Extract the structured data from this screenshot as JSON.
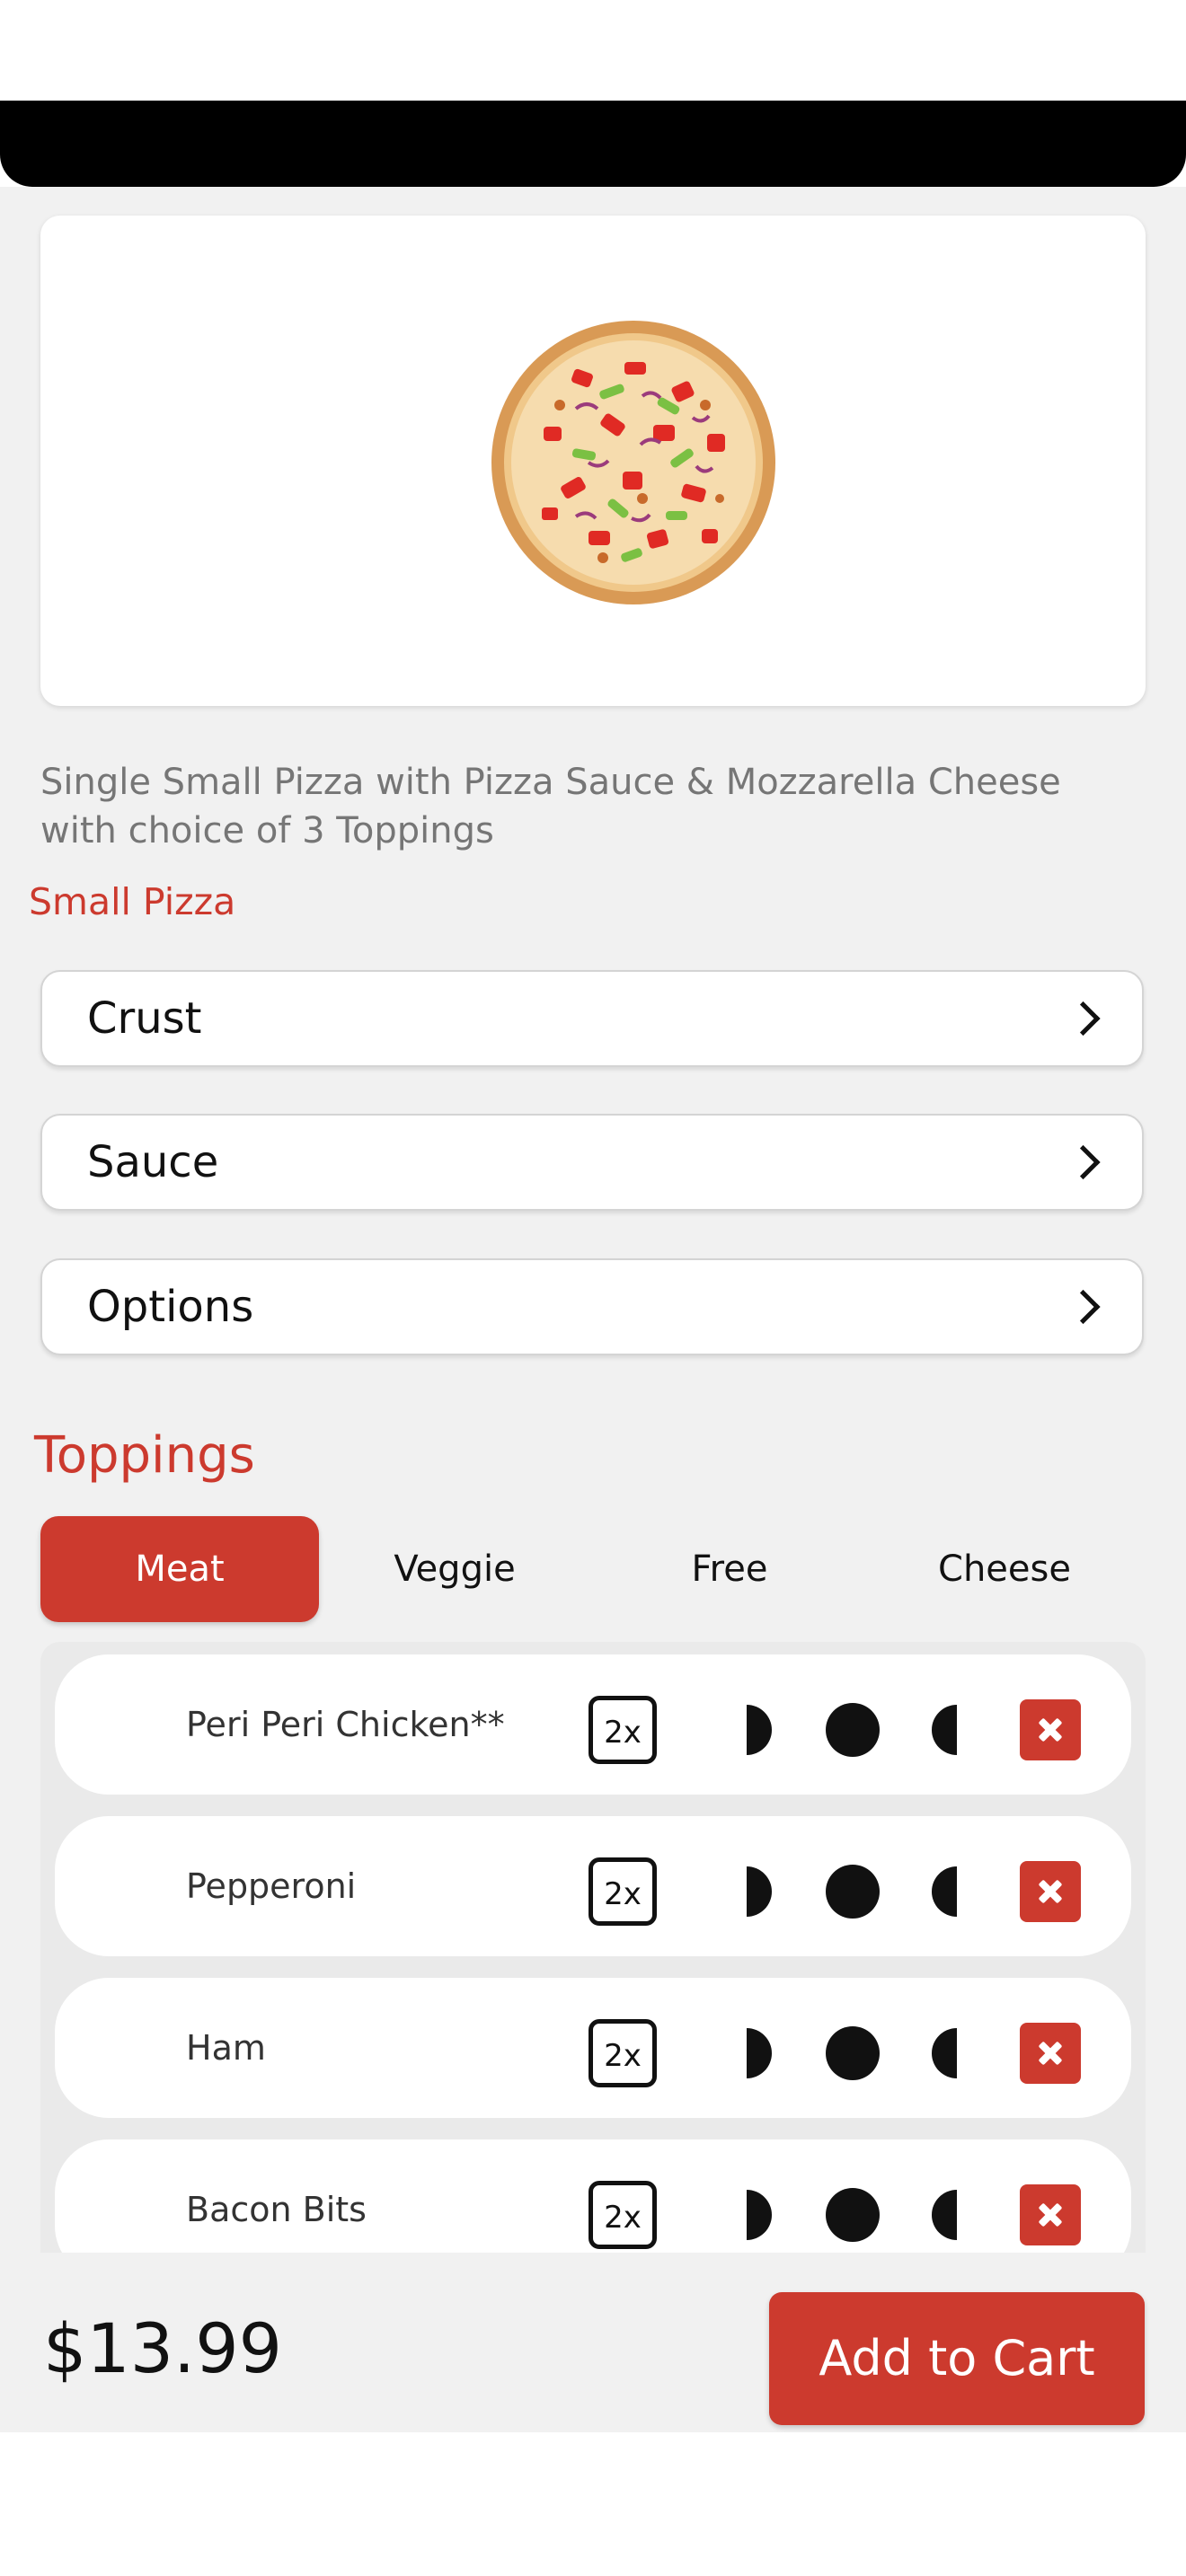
{
  "product": {
    "description": "Single Small Pizza with Pizza Sauce &  Mozzarella Cheese with choice of  3 Toppings",
    "name": "Small  Pizza"
  },
  "options": [
    {
      "label": "Crust"
    },
    {
      "label": "Sauce"
    },
    {
      "label": "Options"
    }
  ],
  "toppings": {
    "title": "Toppings",
    "tabs": [
      "Meat",
      "Veggie",
      "Free",
      "Cheese"
    ],
    "active_tab": "Meat",
    "double_label": "2x",
    "items": [
      {
        "name": "Peri Peri Chicken**"
      },
      {
        "name": "Pepperoni"
      },
      {
        "name": "Ham"
      },
      {
        "name": "Bacon Bits"
      }
    ]
  },
  "footer": {
    "price": "$13.99",
    "add_to_cart": "Add to Cart"
  },
  "colors": {
    "accent": "#cc3a2e",
    "background": "#f1f1f1"
  }
}
